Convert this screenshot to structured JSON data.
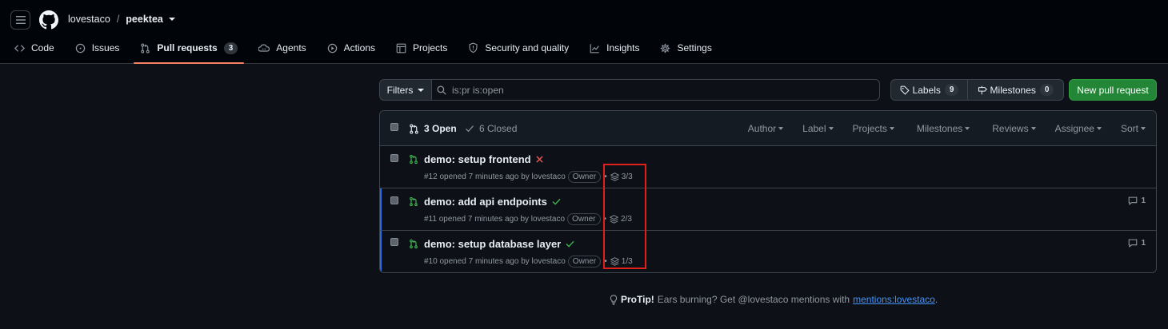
{
  "breadcrumb": {
    "owner": "lovestaco",
    "separator": "/",
    "repo": "peektea"
  },
  "tabs": [
    {
      "label": "Code",
      "icon": "code-icon"
    },
    {
      "label": "Issues",
      "icon": "issue-icon"
    },
    {
      "label": "Pull requests",
      "icon": "pull-request-icon",
      "counter": "3",
      "selected": true
    },
    {
      "label": "Agents",
      "icon": "agent-icon"
    },
    {
      "label": "Actions",
      "icon": "play-icon"
    },
    {
      "label": "Projects",
      "icon": "table-icon"
    },
    {
      "label": "Security and quality",
      "icon": "shield-icon"
    },
    {
      "label": "Insights",
      "icon": "graph-icon"
    },
    {
      "label": "Settings",
      "icon": "gear-icon"
    }
  ],
  "toolbar": {
    "filters_label": "Filters",
    "search_value": "is:pr is:open",
    "labels_label": "Labels",
    "labels_count": "9",
    "milestones_label": "Milestones",
    "milestones_count": "0",
    "new_pr_label": "New pull request"
  },
  "list_header": {
    "open_label": "3 Open",
    "closed_label": "6 Closed",
    "menus": [
      "Author",
      "Label",
      "Projects",
      "Milestones",
      "Reviews",
      "Assignee",
      "Sort"
    ]
  },
  "pull_requests": [
    {
      "title": "demo: setup frontend",
      "status": "failing",
      "meta": "#12 opened 7 minutes ago by lovestaco",
      "badge": "Owner",
      "stack": "3/3",
      "comments": ""
    },
    {
      "title": "demo: add api endpoints",
      "status": "passing",
      "meta": "#11 opened 7 minutes ago by lovestaco",
      "badge": "Owner",
      "stack": "2/3",
      "comments": "1"
    },
    {
      "title": "demo: setup database layer",
      "status": "passing",
      "meta": "#10 opened 7 minutes ago by lovestaco",
      "badge": "Owner",
      "stack": "1/3",
      "comments": "1"
    }
  ],
  "protip": {
    "label": "ProTip!",
    "text": "Ears burning? Get @lovestaco mentions with",
    "link": "mentions:lovestaco",
    "end": "."
  },
  "colors": {
    "background": "#0d1117",
    "header": "#010409",
    "accent_tab": "#f78166",
    "open_green": "#3fb950",
    "fail_red": "#f85149",
    "primary_button": "#238636",
    "link": "#4493f8",
    "highlight_box": "#e0201b"
  }
}
